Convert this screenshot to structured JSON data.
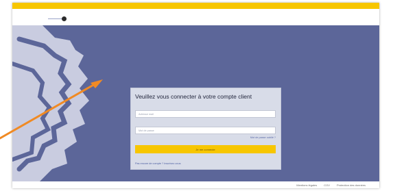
{
  "page": {
    "title": "Veuillez vous connecter à votre compte client",
    "email_placeholder": "Adresse mail",
    "password_placeholder": "Mot de passe",
    "forgot_password": "Mot de passe oublié ?",
    "submit_label": "Je me connecte",
    "create_account": "Pas encore de compte ? Inscrivez-vous"
  },
  "footer": {
    "links": [
      "Mentions légales",
      "CGV",
      "Protection des données"
    ]
  },
  "colors": {
    "accent": "#f7c600",
    "hero": "#5c6699",
    "annotation_arrow": "#f08a24"
  }
}
